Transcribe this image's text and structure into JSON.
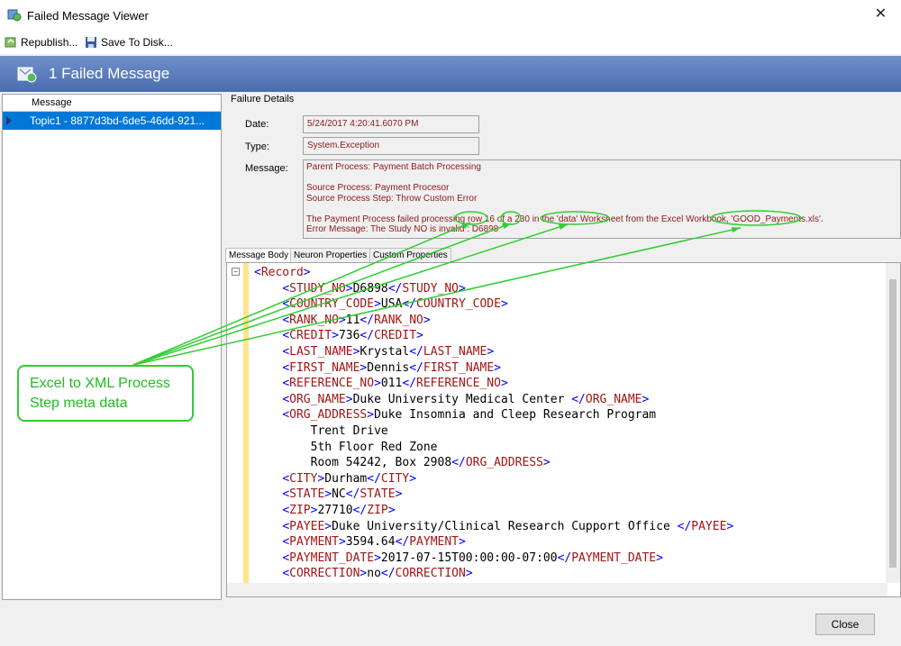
{
  "window": {
    "title": "Failed Message Viewer",
    "close_glyph": "✕"
  },
  "toolbar": {
    "republish_label": "Republish...",
    "save_label": "Save To Disk..."
  },
  "banner": {
    "title": "1 Failed Message"
  },
  "list": {
    "column_header": "Message",
    "rows": [
      "Topic1 - 8877d3bd-6de5-46dd-921..."
    ]
  },
  "failure": {
    "section_label": "Failure Details",
    "date_label": "Date:",
    "date_value": "5/24/2017 4:20:41.6070 PM",
    "type_label": "Type:",
    "type_value": "System.Exception",
    "message_label": "Message:",
    "message_lines": [
      "Parent Process: Payment Batch Processing",
      "",
      "Source Process: Payment Procesor",
      "Source Process Step: Throw Custom Error",
      "",
      "The Payment Process failed processing row 16 of a 230 in the 'data' Worksheet from the Excel Workbook, 'GOOD_Payments.xls'.",
      "Error Message: The Study NO is invalid : D6898"
    ]
  },
  "tabs": [
    "Message Body",
    "Neuron Properties",
    "Custom Properties"
  ],
  "xml_lines": [
    {
      "indent": 0,
      "open": "Record",
      "value": "",
      "close": ""
    },
    {
      "indent": 1,
      "open": "STUDY_NO",
      "value": "D6898",
      "close": "STUDY_NO"
    },
    {
      "indent": 1,
      "open": "COUNTRY_CODE",
      "value": "USA",
      "close": "COUNTRY_CODE"
    },
    {
      "indent": 1,
      "open": "RANK_NO",
      "value": "11",
      "close": "RANK_NO"
    },
    {
      "indent": 1,
      "open": "CREDIT",
      "value": "736",
      "close": "CREDIT"
    },
    {
      "indent": 1,
      "open": "LAST_NAME",
      "value": "Krystal",
      "close": "LAST_NAME"
    },
    {
      "indent": 1,
      "open": "FIRST_NAME",
      "value": "Dennis",
      "close": "FIRST_NAME"
    },
    {
      "indent": 1,
      "open": "REFERENCE_NO",
      "value": "011",
      "close": "REFERENCE_NO"
    },
    {
      "indent": 1,
      "open": "ORG_NAME",
      "value": "Duke University Medical Center ",
      "close": "ORG_NAME"
    },
    {
      "indent": 1,
      "open": "ORG_ADDRESS",
      "value": "Duke Insomnia and Cleep Research Program",
      "close": ""
    },
    {
      "indent": 2,
      "open": "",
      "value": "Trent Drive",
      "close": ""
    },
    {
      "indent": 2,
      "open": "",
      "value": "5th Floor Red Zone",
      "close": ""
    },
    {
      "indent": 2,
      "open": "",
      "value": "Room 54242, Box 2908",
      "close": "ORG_ADDRESS"
    },
    {
      "indent": 1,
      "open": "CITY",
      "value": "Durham",
      "close": "CITY"
    },
    {
      "indent": 1,
      "open": "STATE",
      "value": "NC",
      "close": "STATE"
    },
    {
      "indent": 1,
      "open": "ZIP",
      "value": "27710",
      "close": "ZIP"
    },
    {
      "indent": 1,
      "open": "PAYEE",
      "value": "Duke University/Clinical Research Cupport Office ",
      "close": "PAYEE"
    },
    {
      "indent": 1,
      "open": "PAYMENT",
      "value": "3594.64",
      "close": "PAYMENT"
    },
    {
      "indent": 1,
      "open": "PAYMENT_DATE",
      "value": "2017-07-15T00:00:00-07:00",
      "close": "PAYMENT_DATE"
    },
    {
      "indent": 1,
      "open": "CORRECTION",
      "value": "no",
      "close": "CORRECTION"
    }
  ],
  "annotation": {
    "text": "Excel to XML Process Step meta data",
    "color": "#33cc33"
  },
  "footer": {
    "close_label": "Close"
  },
  "colors": {
    "banner": "#4a6db0",
    "selection": "#0078d7",
    "detail_text": "#8b1a1a",
    "xml_tag": "#a31515",
    "xml_bracket": "#0000ff"
  }
}
